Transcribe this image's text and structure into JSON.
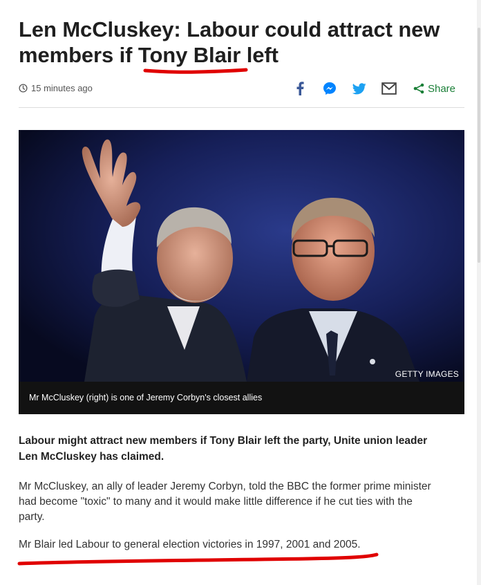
{
  "article": {
    "headline": "Len McCluskey: Labour could attract new members if Tony Blair left",
    "timestamp": "15 minutes ago",
    "share_label": "Share",
    "image": {
      "credit": "GETTY IMAGES",
      "caption": "Mr McCluskey (right) is one of Jeremy Corbyn's closest allies"
    },
    "intro": "Labour might attract new members if Tony Blair left the party, Unite union leader Len McCluskey has claimed.",
    "paragraphs": [
      "Mr McCluskey, an ally of leader Jeremy Corbyn, told the BBC the former prime minister had become \"toxic\" to many and it would make little difference if he cut ties with the party.",
      "Mr Blair led Labour to general election victories in 1997, 2001 and 2005."
    ]
  },
  "icons": {
    "clock": "clock-icon",
    "facebook": "facebook-icon",
    "messenger": "messenger-icon",
    "twitter": "twitter-icon",
    "email": "email-icon",
    "share": "share-icon"
  },
  "colors": {
    "facebook": "#3b5998",
    "messenger": "#0084ff",
    "twitter": "#1da1f2",
    "share": "#1a7f37",
    "annotation_red": "#e00000",
    "caption_bg": "#121212"
  }
}
